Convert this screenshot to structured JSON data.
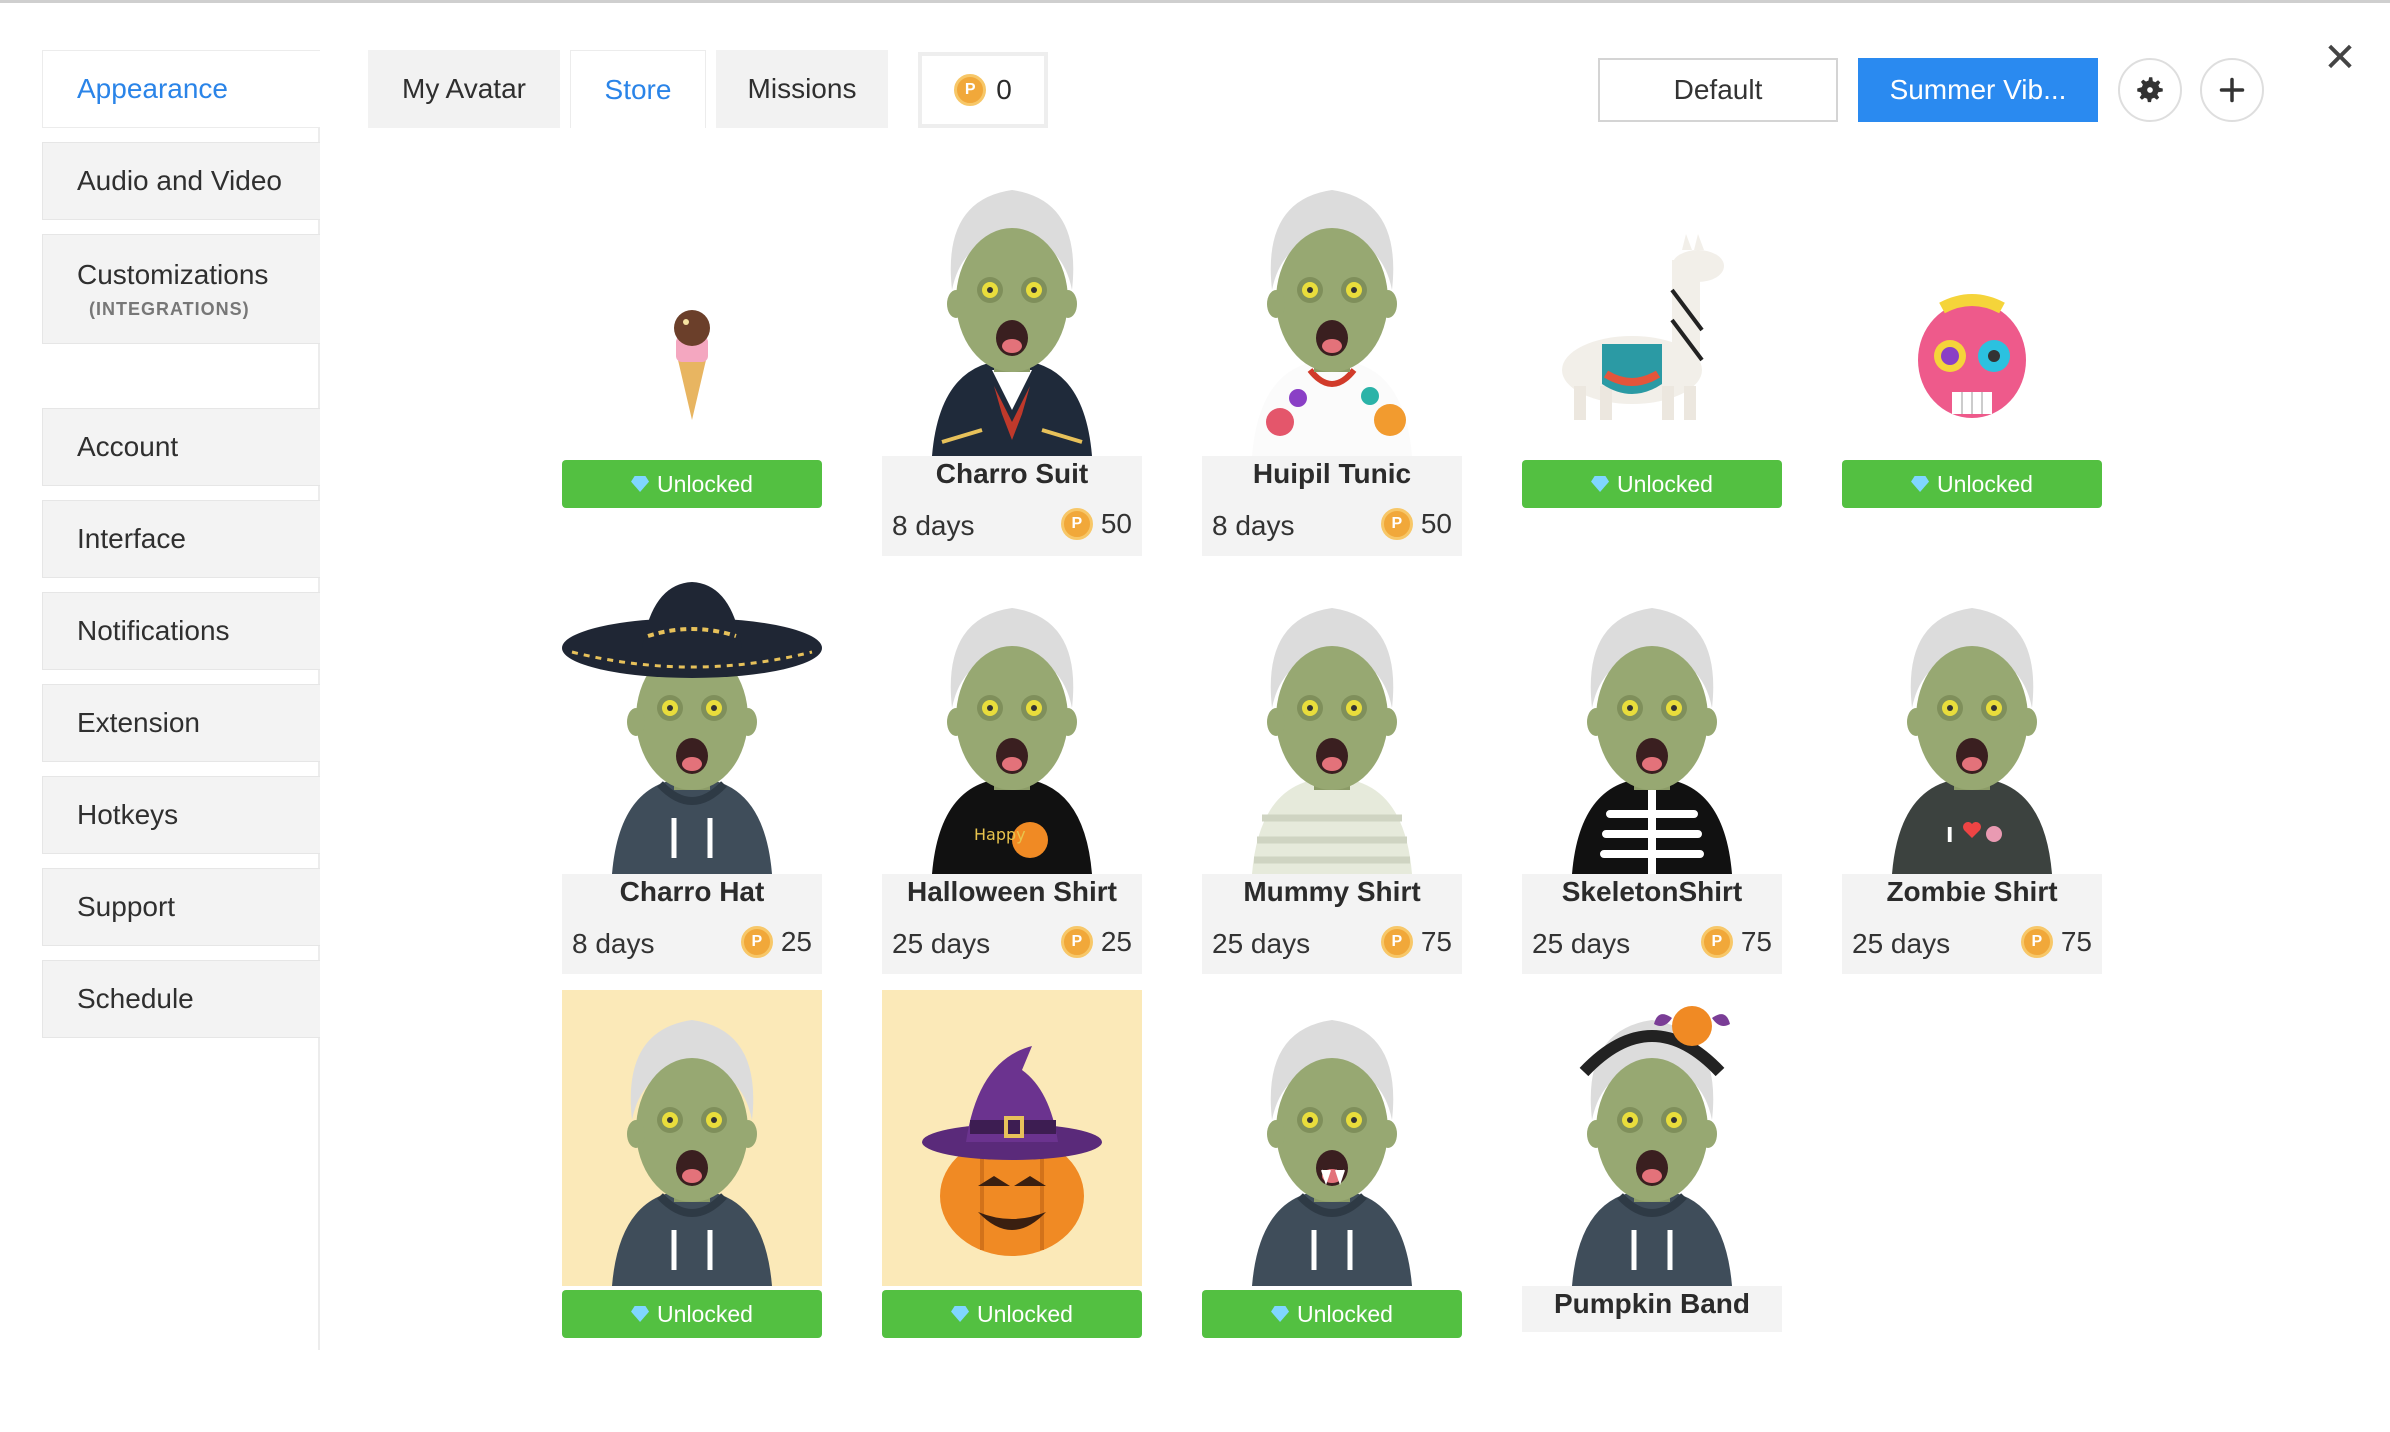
{
  "window": {
    "close_label": "✕"
  },
  "sidebar": {
    "items": [
      {
        "label": "Appearance"
      },
      {
        "label": "Audio and Video"
      },
      {
        "label": "Customizations",
        "sub": "(INTEGRATIONS)"
      },
      {
        "label": "Account"
      },
      {
        "label": "Interface"
      },
      {
        "label": "Notifications"
      },
      {
        "label": "Extension"
      },
      {
        "label": "Hotkeys"
      },
      {
        "label": "Support"
      },
      {
        "label": "Schedule"
      }
    ]
  },
  "tabs": [
    {
      "label": "My Avatar"
    },
    {
      "label": "Store"
    },
    {
      "label": "Missions"
    }
  ],
  "coins": {
    "icon": "coin-icon",
    "count": "0"
  },
  "presets": {
    "default_label": "Default",
    "summer_label": "Summer Vib..."
  },
  "store": {
    "unlocked_label": "Unlocked",
    "items": [
      {
        "name": "",
        "status": "unlocked",
        "art": "ice-cream"
      },
      {
        "name": "Charro Suit",
        "days": "8 days",
        "price": "50",
        "art": "zombie-charro-suit"
      },
      {
        "name": "Huipil Tunic",
        "days": "8 days",
        "price": "50",
        "art": "zombie-huipil"
      },
      {
        "name": "",
        "status": "unlocked",
        "art": "llama"
      },
      {
        "name": "",
        "status": "unlocked",
        "art": "sugar-skull"
      },
      {
        "name": "Charro Hat",
        "days": "8 days",
        "price": "25",
        "art": "zombie-sombrero"
      },
      {
        "name": "Halloween Shirt",
        "days": "25 days",
        "price": "25",
        "art": "zombie-halloween-shirt"
      },
      {
        "name": "Mummy Shirt",
        "days": "25 days",
        "price": "75",
        "art": "zombie-mummy-shirt"
      },
      {
        "name": "SkeletonShirt",
        "days": "25 days",
        "price": "75",
        "art": "zombie-skeleton-shirt"
      },
      {
        "name": "Zombie Shirt",
        "days": "25 days",
        "price": "75",
        "art": "zombie-shirt"
      },
      {
        "name": "",
        "status": "unlocked",
        "art": "zombie-hoodie"
      },
      {
        "name": "",
        "status": "unlocked",
        "art": "pumpkin-witch-hat"
      },
      {
        "name": "",
        "status": "unlocked",
        "art": "zombie-fangs"
      },
      {
        "name": "Pumpkin Band",
        "art": "zombie-pumpkin-band"
      }
    ]
  },
  "colors": {
    "accent": "#2a84e8",
    "unlocked_green": "#53c041",
    "zombie_skin": "#97a872"
  }
}
